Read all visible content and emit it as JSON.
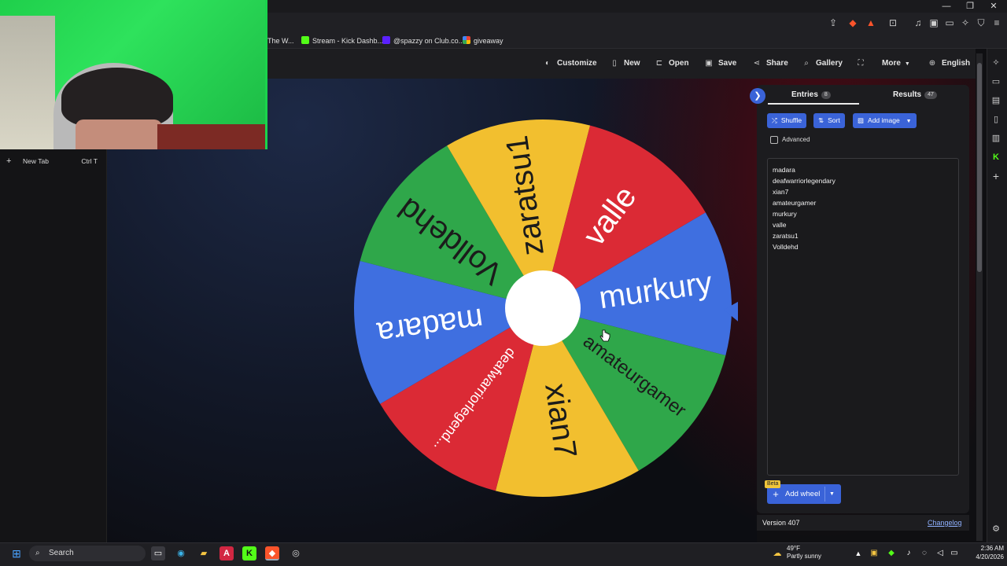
{
  "window": {
    "controls": [
      "—",
      "❐",
      "✕"
    ]
  },
  "bookmarks": [
    {
      "label": "The W...",
      "color": "#4a90e2"
    },
    {
      "label": "Stream - Kick Dashb...",
      "color": "#53fc18"
    },
    {
      "label": "@spazzy on Club.co...",
      "color": "#5b21ff"
    },
    {
      "label": "giveaway",
      "color": "#ea4335"
    }
  ],
  "sidebar_left": {
    "new_tab_label": "New Tab",
    "new_tab_shortcut": "Ctrl T"
  },
  "toolbar": {
    "customize": "Customize",
    "new": "New",
    "open": "Open",
    "save": "Save",
    "share": "Share",
    "gallery": "Gallery",
    "more": "More",
    "language": "English"
  },
  "wheel": {
    "colors": {
      "yellow": "#f2bf2f",
      "red": "#db2a35",
      "blue": "#3f6fe0",
      "green": "#2fa74a",
      "hub": "#ffffff",
      "pointer": "#3f6fe0"
    },
    "segments": [
      {
        "label": "murkury",
        "color": "#3f6fe0",
        "text_color": "#ffffff"
      },
      {
        "label": "amateurgamer",
        "color": "#2fa74a",
        "text_color": "#1b1b1b"
      },
      {
        "label": "xian7",
        "color": "#f2bf2f",
        "text_color": "#1b1b1b"
      },
      {
        "label": "deafwarriorlegend...",
        "color": "#db2a35",
        "text_color": "#ffffff"
      },
      {
        "label": "madara",
        "color": "#3f6fe0",
        "text_color": "#ffffff"
      },
      {
        "label": "Volldehd",
        "color": "#2fa74a",
        "text_color": "#1b1b1b"
      },
      {
        "label": "zaratsu1",
        "color": "#f2bf2f",
        "text_color": "#1b1b1b"
      },
      {
        "label": "valle",
        "color": "#db2a35",
        "text_color": "#ffffff"
      }
    ]
  },
  "panel": {
    "entries_tab": "Entries",
    "entries_count": "8",
    "results_tab": "Results",
    "results_count": "47",
    "shuffle": "Shuffle",
    "sort": "Sort",
    "add_image": "Add image",
    "advanced": "Advanced",
    "entries": [
      "madara",
      "deafwarriorlegendary",
      "xian7",
      "amateurgamer",
      "murkury",
      "valle",
      "zaratsu1",
      "Volldehd"
    ],
    "beta": "Beta",
    "add_wheel": "Add wheel",
    "version": "Version 407",
    "changelog": "Changelog"
  },
  "taskbar": {
    "search": "Search",
    "weather_temp": "49°F",
    "weather_desc": "Partly sunny",
    "time": "2:36 AM",
    "date": "4/20/2026"
  }
}
